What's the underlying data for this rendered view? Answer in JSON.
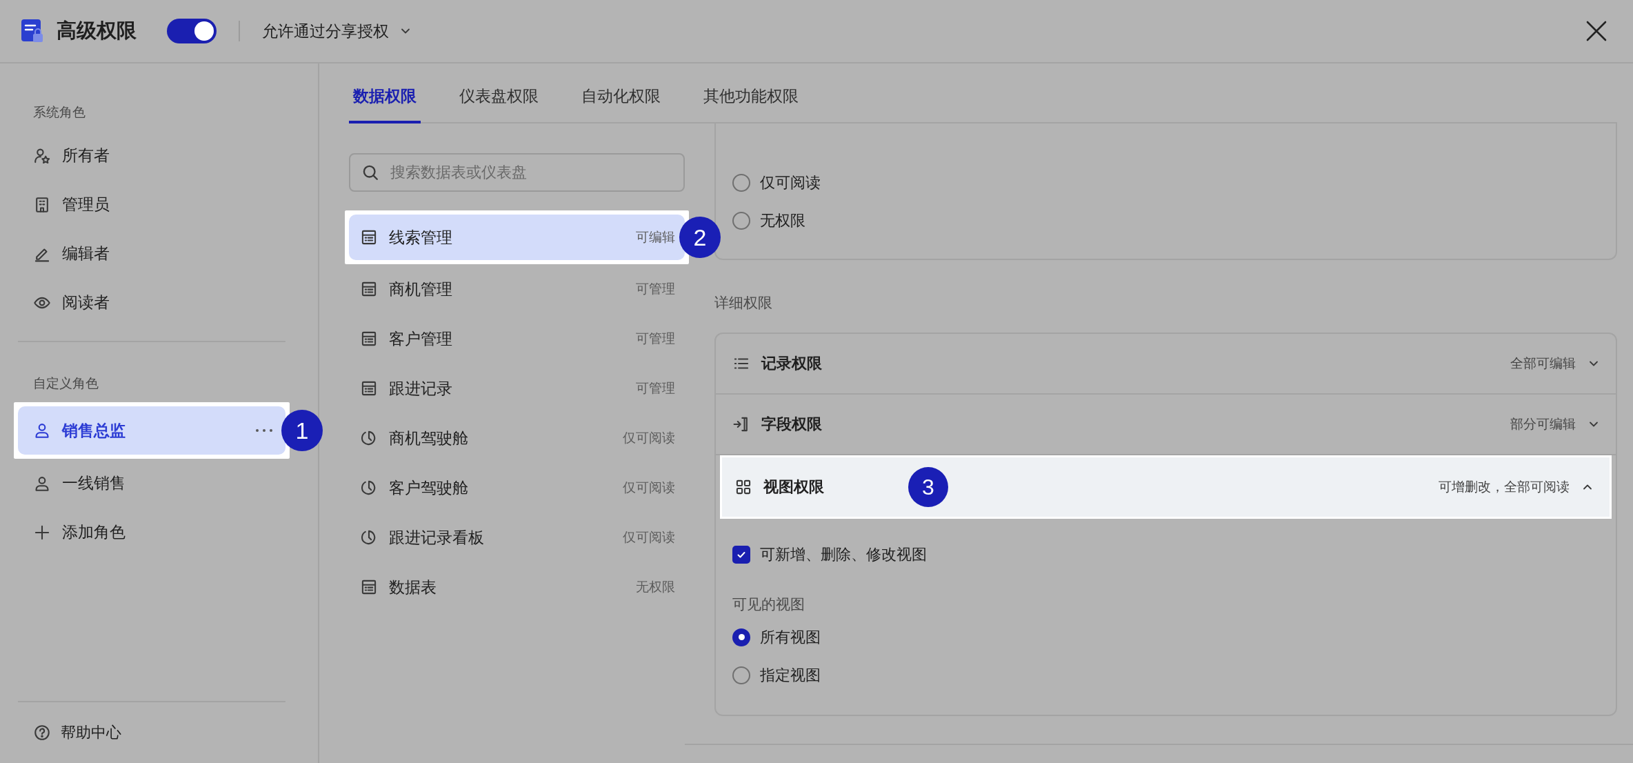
{
  "header": {
    "title": "高级权限",
    "toggle_on": true,
    "share_option": "允许通过分享授权"
  },
  "sidebar": {
    "sections": [
      {
        "label": "系统角色",
        "items": [
          {
            "kind": "owner",
            "label": "所有者",
            "selected": false
          },
          {
            "kind": "admin",
            "label": "管理员",
            "selected": false
          },
          {
            "kind": "editor",
            "label": "编辑者",
            "selected": false
          },
          {
            "kind": "reader",
            "label": "阅读者",
            "selected": false
          }
        ]
      },
      {
        "label": "自定义角色",
        "items": [
          {
            "kind": "person",
            "label": "销售总监",
            "selected": true,
            "callout": "1"
          },
          {
            "kind": "person",
            "label": "一线销售",
            "selected": false
          },
          {
            "kind": "add",
            "label": "添加角色",
            "selected": false
          }
        ]
      }
    ],
    "help": "帮助中心"
  },
  "tabs": [
    {
      "label": "数据权限",
      "selected": true
    },
    {
      "label": "仪表盘权限",
      "selected": false
    },
    {
      "label": "自动化权限",
      "selected": false
    },
    {
      "label": "其他功能权限",
      "selected": false
    }
  ],
  "search": {
    "placeholder": "搜索数据表或仪表盘"
  },
  "resources": [
    {
      "kind": "table",
      "name": "线索管理",
      "permission": "可编辑",
      "selected": true,
      "callout": "2"
    },
    {
      "kind": "table",
      "name": "商机管理",
      "permission": "可管理",
      "selected": false
    },
    {
      "kind": "table",
      "name": "客户管理",
      "permission": "可管理",
      "selected": false
    },
    {
      "kind": "table",
      "name": "跟进记录",
      "permission": "可管理",
      "selected": false
    },
    {
      "kind": "dashboard",
      "name": "商机驾驶舱",
      "permission": "仅可阅读",
      "selected": false
    },
    {
      "kind": "dashboard",
      "name": "客户驾驶舱",
      "permission": "仅可阅读",
      "selected": false
    },
    {
      "kind": "dashboard",
      "name": "跟进记录看板",
      "permission": "仅可阅读",
      "selected": false
    },
    {
      "kind": "table",
      "name": "数据表",
      "permission": "无权限",
      "selected": false
    }
  ],
  "access_options": [
    {
      "label": "仅可阅读",
      "selected": false
    },
    {
      "label": "无权限",
      "selected": false
    }
  ],
  "detail": {
    "title": "详细权限",
    "sections": [
      {
        "kind": "records",
        "label": "记录权限",
        "summary": "全部可编辑",
        "expanded": false
      },
      {
        "kind": "fields",
        "label": "字段权限",
        "summary": "部分可编辑",
        "expanded": false
      },
      {
        "kind": "views",
        "label": "视图权限",
        "summary": "可增删改，全部可阅读",
        "expanded": true,
        "callout": "3",
        "can_modify": {
          "label": "可新增、删除、修改视图",
          "checked": true
        },
        "visible_label": "可见的视图",
        "visible_options": [
          {
            "label": "所有视图",
            "selected": true
          },
          {
            "label": "指定视图",
            "selected": false
          }
        ]
      }
    ]
  }
}
